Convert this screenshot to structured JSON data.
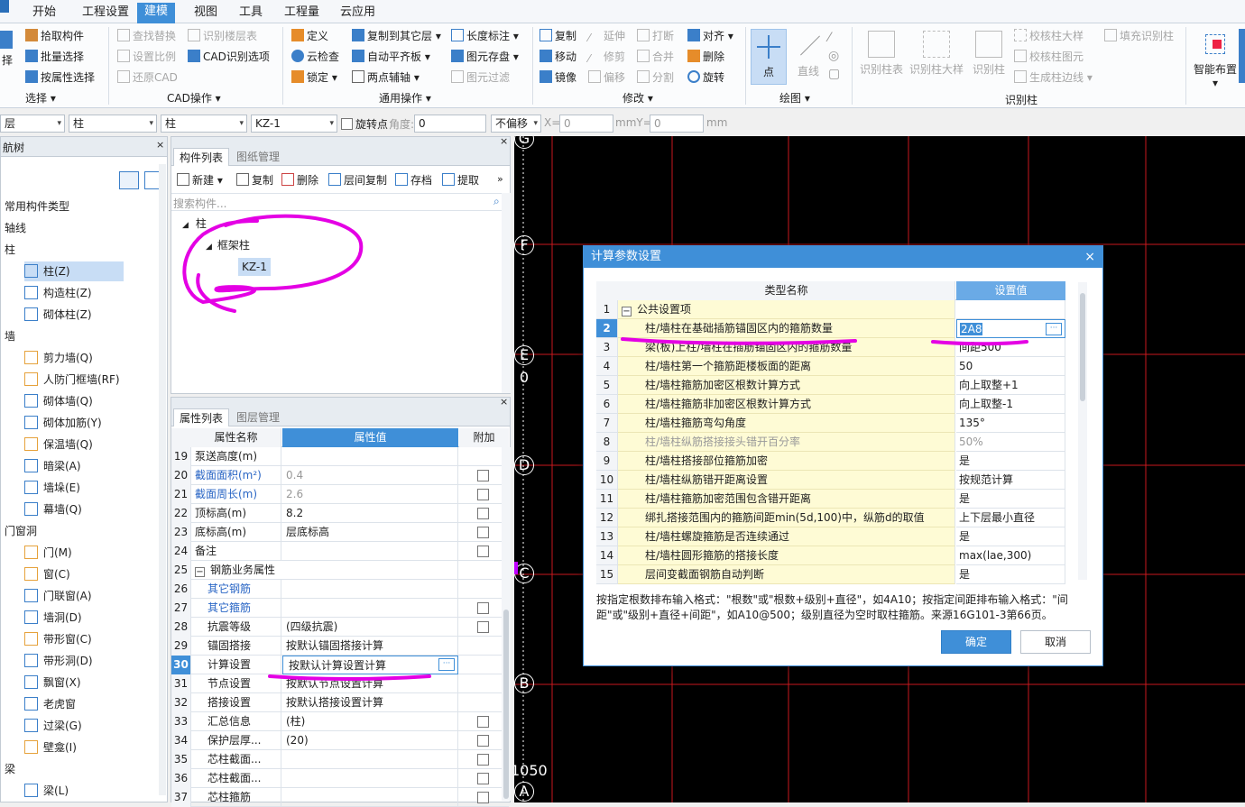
{
  "menubar": {
    "items": [
      "开始",
      "工程设置",
      "建模",
      "视图",
      "工具",
      "工程量",
      "云应用"
    ],
    "active_index": 2
  },
  "ribbon": {
    "select": {
      "buttons": [
        "拾取构件",
        "批量选择",
        "按属性选择"
      ],
      "big_partial": "择",
      "label": "选择"
    },
    "cad": {
      "buttons": [
        "查找替换",
        "识别楼层表",
        "设置比例",
        "CAD识别选项",
        "还原CAD"
      ],
      "label": "CAD操作"
    },
    "common": {
      "buttons": [
        "定义",
        "复制到其它层",
        "长度标注",
        "云检查",
        "自动平齐板",
        "图元存盘",
        "锁定",
        "两点辅轴",
        "图元过滤"
      ],
      "label": "通用操作"
    },
    "modify": {
      "buttons": [
        "复制",
        "延伸",
        "打断",
        "对齐",
        "移动",
        "修剪",
        "合并",
        "删除",
        "镜像",
        "偏移",
        "分割",
        "旋转"
      ],
      "label": "修改"
    },
    "draw": {
      "buttons": [
        "点",
        "直线"
      ],
      "label": "绘图"
    },
    "recognize": {
      "buttons": [
        "识别柱表",
        "识别柱大样",
        "识别柱",
        "校核柱大样",
        "填充识别柱",
        "校核柱图元",
        "生成柱边线"
      ],
      "label": "识别柱"
    },
    "smart": {
      "label": "智能布置"
    }
  },
  "propbar": {
    "floor": "层",
    "type1": "柱",
    "type2": "柱",
    "component": "KZ-1",
    "rotate_label": "旋转点",
    "angle_label": "角度:",
    "angle_value": "0",
    "offset": "不偏移",
    "x_label": "X=",
    "x_value": "0",
    "mmy_label": "mmY=",
    "y_value": "0",
    "mm_label": "mm"
  },
  "nav_tree": {
    "title": "航树",
    "items": [
      {
        "label": "常用构件类型",
        "kind": "header"
      },
      {
        "label": "轴线",
        "kind": "header"
      },
      {
        "label": "柱",
        "kind": "header"
      },
      {
        "label": "柱(Z)",
        "kind": "item",
        "selected": true
      },
      {
        "label": "构造柱(Z)",
        "kind": "item"
      },
      {
        "label": "砌体柱(Z)",
        "kind": "item"
      },
      {
        "label": "墙",
        "kind": "header"
      },
      {
        "label": "剪力墙(Q)",
        "kind": "item"
      },
      {
        "label": "人防门框墙(RF)",
        "kind": "item"
      },
      {
        "label": "砌体墙(Q)",
        "kind": "item"
      },
      {
        "label": "砌体加筋(Y)",
        "kind": "item"
      },
      {
        "label": "保温墙(Q)",
        "kind": "item"
      },
      {
        "label": "暗梁(A)",
        "kind": "item"
      },
      {
        "label": "墙垛(E)",
        "kind": "item"
      },
      {
        "label": "幕墙(Q)",
        "kind": "item"
      },
      {
        "label": "门窗洞",
        "kind": "header"
      },
      {
        "label": "门(M)",
        "kind": "item"
      },
      {
        "label": "窗(C)",
        "kind": "item"
      },
      {
        "label": "门联窗(A)",
        "kind": "item"
      },
      {
        "label": "墙洞(D)",
        "kind": "item"
      },
      {
        "label": "带形窗(C)",
        "kind": "item"
      },
      {
        "label": "带形洞(D)",
        "kind": "item"
      },
      {
        "label": "飘窗(X)",
        "kind": "item"
      },
      {
        "label": "老虎窗",
        "kind": "item"
      },
      {
        "label": "过梁(G)",
        "kind": "item"
      },
      {
        "label": "壁龛(I)",
        "kind": "item"
      },
      {
        "label": "梁",
        "kind": "header"
      },
      {
        "label": "梁(L)",
        "kind": "item"
      }
    ]
  },
  "component_panel": {
    "tabs": [
      "构件列表",
      "图纸管理"
    ],
    "toolbar": [
      "新建",
      "复制",
      "删除",
      "层间复制",
      "存档",
      "提取"
    ],
    "search_placeholder": "搜索构件...",
    "tree": [
      "柱",
      "框架柱",
      "KZ-1"
    ]
  },
  "property_panel": {
    "tabs": [
      "属性列表",
      "图层管理"
    ],
    "headers": [
      "属性名称",
      "属性值",
      "附加"
    ],
    "rows": [
      {
        "num": "19",
        "name": "泵送高度(m)",
        "value": "",
        "check": false,
        "style": ""
      },
      {
        "num": "20",
        "name": "截面面积(m²)",
        "value": "0.4",
        "check": true,
        "style": "blue"
      },
      {
        "num": "21",
        "name": "截面周长(m)",
        "value": "2.6",
        "check": true,
        "style": "blue"
      },
      {
        "num": "22",
        "name": "顶标高(m)",
        "value": "8.2",
        "check": true,
        "style": ""
      },
      {
        "num": "23",
        "name": "底标高(m)",
        "value": "层底标高",
        "check": true,
        "style": ""
      },
      {
        "num": "24",
        "name": "备注",
        "value": "",
        "check": true,
        "style": ""
      },
      {
        "num": "25",
        "name": "钢筋业务属性",
        "value": "",
        "check": false,
        "style": "group"
      },
      {
        "num": "26",
        "name": "其它钢筋",
        "value": "",
        "check": false,
        "style": "blue"
      },
      {
        "num": "27",
        "name": "其它箍筋",
        "value": "",
        "check": true,
        "style": "blue"
      },
      {
        "num": "28",
        "name": "抗震等级",
        "value": "(四级抗震)",
        "check": true,
        "style": ""
      },
      {
        "num": "29",
        "name": "锚固搭接",
        "value": "按默认锚固搭接计算",
        "check": false,
        "style": ""
      },
      {
        "num": "30",
        "name": "计算设置",
        "value": "按默认计算设置计算",
        "check": false,
        "style": "selected"
      },
      {
        "num": "31",
        "name": "节点设置",
        "value": "按默认节点设置计算",
        "check": false,
        "style": ""
      },
      {
        "num": "32",
        "name": "搭接设置",
        "value": "按默认搭接设置计算",
        "check": false,
        "style": ""
      },
      {
        "num": "33",
        "name": "汇总信息",
        "value": "(柱)",
        "check": true,
        "style": ""
      },
      {
        "num": "34",
        "name": "保护层厚...",
        "value": "(20)",
        "check": true,
        "style": ""
      },
      {
        "num": "35",
        "name": "芯柱截面...",
        "value": "",
        "check": true,
        "style": ""
      },
      {
        "num": "36",
        "name": "芯柱截面...",
        "value": "",
        "check": true,
        "style": ""
      },
      {
        "num": "37",
        "name": "芯柱箍筋",
        "value": "",
        "check": true,
        "style": ""
      }
    ]
  },
  "canvas": {
    "axis_labels": [
      "G",
      "F",
      "E",
      "0",
      "D",
      "C",
      "B",
      "A"
    ],
    "dimension_text": "1050"
  },
  "dialog": {
    "title": "计算参数设置",
    "headers": [
      "类型名称",
      "设置值"
    ],
    "rows": [
      {
        "num": "1",
        "name": "公共设置项",
        "value": "",
        "kind": "group"
      },
      {
        "num": "2",
        "name": "柱/墙柱在基础插筋锚固区内的箍筋数量",
        "value": "2A8",
        "kind": "selected"
      },
      {
        "num": "3",
        "name": "梁(板)上柱/墙柱在插筋锚固区内的箍筋数量",
        "value": "间距500",
        "kind": ""
      },
      {
        "num": "4",
        "name": "柱/墙柱第一个箍筋距楼板面的距离",
        "value": "50",
        "kind": ""
      },
      {
        "num": "5",
        "name": "柱/墙柱箍筋加密区根数计算方式",
        "value": "向上取整+1",
        "kind": ""
      },
      {
        "num": "6",
        "name": "柱/墙柱箍筋非加密区根数计算方式",
        "value": "向上取整-1",
        "kind": ""
      },
      {
        "num": "7",
        "name": "柱/墙柱箍筋弯勾角度",
        "value": "135°",
        "kind": ""
      },
      {
        "num": "8",
        "name": "柱/墙柱纵筋搭接接头错开百分率",
        "value": "50%",
        "kind": "gray"
      },
      {
        "num": "9",
        "name": "柱/墙柱搭接部位箍筋加密",
        "value": "是",
        "kind": ""
      },
      {
        "num": "10",
        "name": "柱/墙柱纵筋错开距离设置",
        "value": "按规范计算",
        "kind": ""
      },
      {
        "num": "11",
        "name": "柱/墙柱箍筋加密范围包含错开距离",
        "value": "是",
        "kind": ""
      },
      {
        "num": "12",
        "name": "绑扎搭接范围内的箍筋间距min(5d,100)中，纵筋d的取值",
        "value": "上下层最小直径",
        "kind": ""
      },
      {
        "num": "13",
        "name": "柱/墙柱螺旋箍筋是否连续通过",
        "value": "是",
        "kind": ""
      },
      {
        "num": "14",
        "name": "柱/墙柱圆形箍筋的搭接长度",
        "value": "max(lae,300)",
        "kind": ""
      },
      {
        "num": "15",
        "name": "层间变截面钢筋自动判断",
        "value": "是",
        "kind": ""
      }
    ],
    "hint_line1": "按指定根数排布输入格式：\"根数\"或\"根数+级别+直径\"，如4A10；按指定间距排布输入格式：\"间",
    "hint_line2": "距\"或\"级别+直径+间距\"，如A10@500；级别直径为空时取柱箍筋。来源16G101-3第66页。",
    "ok_label": "确定",
    "cancel_label": "取消"
  },
  "colors": {
    "accent": "#3f8fd8",
    "annotation": "#e400e4",
    "grid": "#c8191e",
    "highlight_yellow": "#fefbd5"
  }
}
